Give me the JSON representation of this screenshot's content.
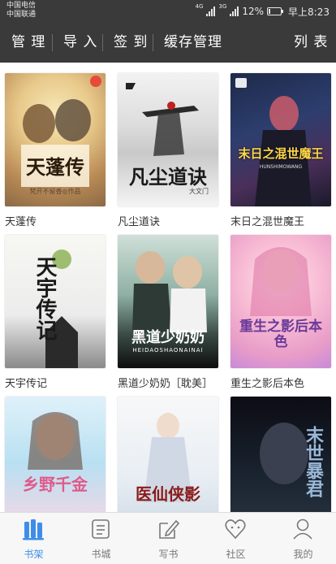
{
  "status_bar": {
    "carrier_1": "中国电信",
    "carrier_2": "中国联通",
    "network_1": "4G",
    "network_2": "3G",
    "battery": "12%",
    "time": "早上8:23"
  },
  "toolbar": {
    "manage": "管 理",
    "import": "导 入",
    "checkin": "签 到",
    "cache": "缓存管理",
    "list": "列 表"
  },
  "books": [
    {
      "title": "天蓬传",
      "cover_text": "天蓬传",
      "cover_sub": "梵开不留香◎作品"
    },
    {
      "title": "凡尘道诀",
      "cover_text": "凡尘道诀",
      "cover_sub": "大文门"
    },
    {
      "title": "末日之混世魔王",
      "cover_text": "末日之混世魔王",
      "cover_sub": "HUNSHIMOWANG"
    },
    {
      "title": "天宇传记",
      "cover_text": "天宇传记",
      "cover_sub": ""
    },
    {
      "title": "黑道少奶奶［耽美］",
      "cover_text": "黑道少奶奶",
      "cover_sub": "HEIDAOSHAONAINAI"
    },
    {
      "title": "重生之影后本色",
      "cover_text": "重生之影后本色",
      "cover_sub": ""
    },
    {
      "title": "",
      "cover_text": "乡野千金",
      "cover_sub": ""
    },
    {
      "title": "",
      "cover_text": "医仙侠影",
      "cover_sub": ""
    },
    {
      "title": "",
      "cover_text": "末世暴君",
      "cover_sub": ""
    }
  ],
  "tabs": [
    {
      "label": "书架",
      "icon": "bookshelf-icon",
      "active": true
    },
    {
      "label": "书城",
      "icon": "bookstore-icon",
      "active": false
    },
    {
      "label": "写书",
      "icon": "write-icon",
      "active": false
    },
    {
      "label": "社区",
      "icon": "community-icon",
      "active": false
    },
    {
      "label": "我的",
      "icon": "profile-icon",
      "active": false
    }
  ],
  "colors": {
    "toolbar_bg": "#3a3a3a",
    "accent": "#3e8ee8",
    "tab_inactive": "#777777"
  }
}
